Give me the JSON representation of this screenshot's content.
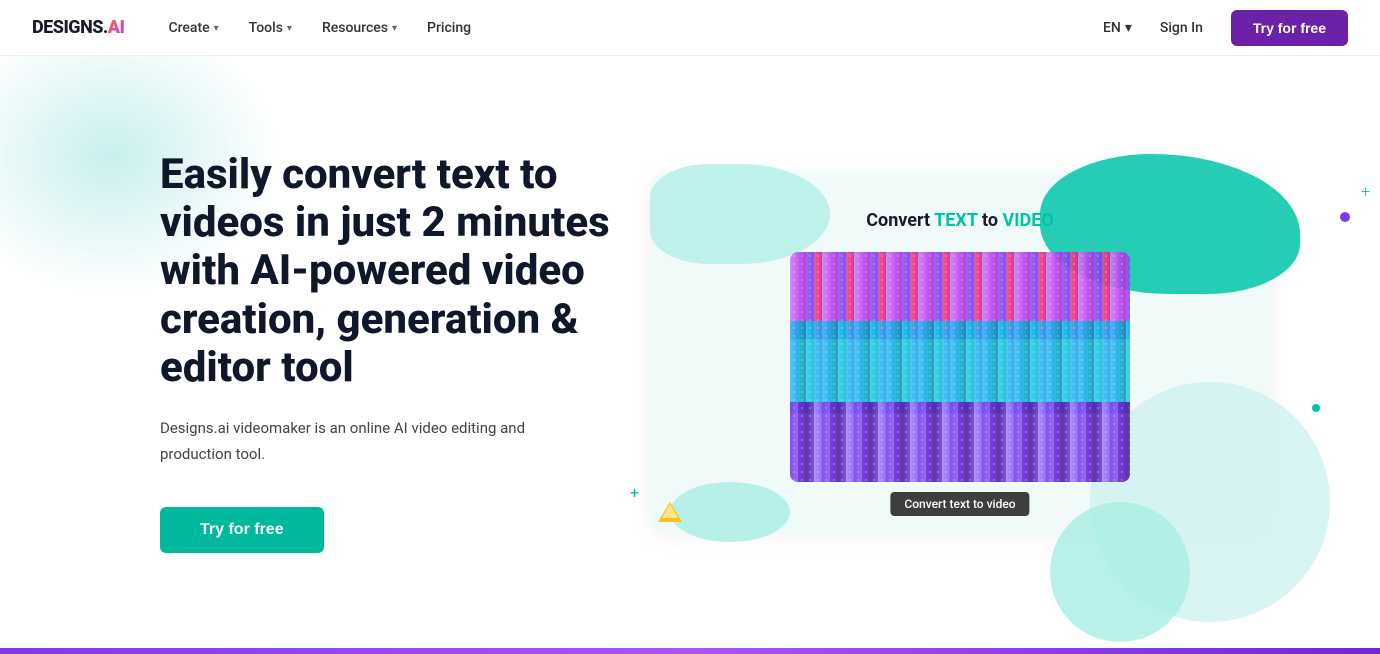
{
  "logo": {
    "text": "DESIGNS.",
    "ai": "AI"
  },
  "nav": {
    "items": [
      {
        "label": "Create",
        "hasDropdown": true
      },
      {
        "label": "Tools",
        "hasDropdown": true
      },
      {
        "label": "Resources",
        "hasDropdown": true
      },
      {
        "label": "Pricing",
        "hasDropdown": false
      }
    ],
    "lang": "EN",
    "sign_in": "Sign In",
    "try_free": "Try for free"
  },
  "hero": {
    "headline": "Easily convert text to videos in just 2 minutes with AI-powered video creation, generation & editor tool",
    "subtext": "Designs.ai videomaker is an online AI video editing and production tool.",
    "cta": "Try for free",
    "illustration": {
      "convert_label_prefix": "Convert ",
      "convert_label_text": "TEXT",
      "convert_label_middle": " to ",
      "convert_label_video": "VIDEO",
      "bottom_label": "Convert text to video"
    }
  }
}
